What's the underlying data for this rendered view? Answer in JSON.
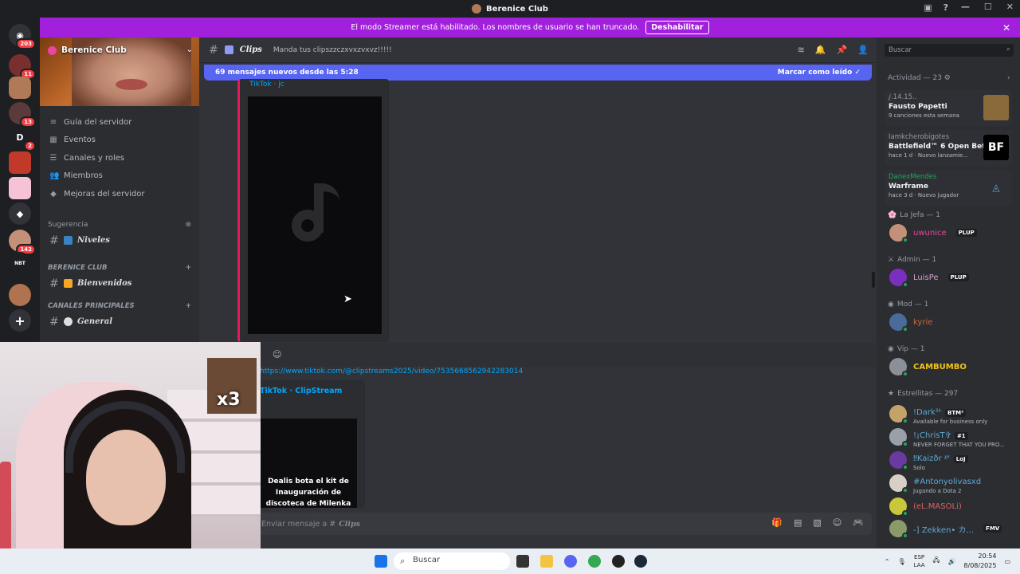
{
  "titlebar": {
    "title": "Berenice Club"
  },
  "guilds": [
    {
      "badge": "203"
    },
    {
      "badge": "11"
    },
    {
      "badge": ""
    },
    {
      "badge": "13"
    },
    {
      "badge": "2",
      "letter": "D"
    },
    {
      "badge": ""
    },
    {
      "badge": ""
    },
    {
      "badge": ""
    },
    {
      "badge": "142"
    },
    {
      "badge": "",
      "letter": "NBT"
    },
    {
      "badge": ""
    }
  ],
  "banner": {
    "text": "El modo Streamer está habilitado. Los nombres de usuario se han truncado.",
    "button": "Deshabilitar"
  },
  "sidebar": {
    "server_name": "Berenice Club",
    "menu": [
      {
        "icon": "≡",
        "label": "Guía del servidor"
      },
      {
        "icon": "▦",
        "label": "Eventos"
      },
      {
        "icon": "☰",
        "label": "Canales y roles"
      },
      {
        "icon": "👥",
        "label": "Miembros"
      },
      {
        "icon": "◆",
        "label": "Mejoras del servidor"
      }
    ],
    "suggestion_label": "Sugerencia",
    "suggestion_channel": "Niveles",
    "section1": "BERENICE CLUB",
    "channel_welcome": "Bienvenidos",
    "section2": "CANALES PRINCIPALES",
    "channel_general": "General"
  },
  "channel": {
    "name": "Clips",
    "topic": "Manda tus clipszzczxvxzvxvz!!!!!",
    "new_messages": "69 mensajes nuevos desde las 5:28",
    "mark_read": "Marcar como leído"
  },
  "messages": {
    "embed1_source": "TikTok · jc",
    "link": "https://www.tiktok.com/@clipstreams2025/video/7535668562942283014",
    "embed2_source": "TikTok · ClipStream",
    "embed2_caption": "Dealis bota el kit de Inauguración de discoteca de Milenka"
  },
  "composer": {
    "placeholder": "Enviar mensaje a #",
    "channel": "Clips"
  },
  "search": {
    "placeholder": "Buscar"
  },
  "activity": {
    "heading": "Actividad — 23",
    "cards": [
      {
        "who": "ⅉ.14.15..",
        "title": "Fausto Papetti",
        "sub": "9 canciones esta semana",
        "color": "#8a6a3a"
      },
      {
        "who": "Iamkcherobigotes",
        "title": "Battlefield™ 6 Open Beta",
        "sub": "hace 1 d · Nuevo lanzamie...",
        "color": "#000000",
        "img_text": "BF"
      },
      {
        "who": "DanexMendes",
        "title": "Warframe",
        "sub": "hace 3 d · Nuevo jugador",
        "color": "#2b2d31"
      }
    ]
  },
  "members": {
    "role_jefa": "La Jefa — 1",
    "jefa": {
      "name": "uwunice",
      "tag": "PLUP",
      "color": "#eb459f"
    },
    "role_admin": "Admin — 1",
    "admin": {
      "name": "LuisPe",
      "tag": "PLUP",
      "color": "#d49ec8"
    },
    "role_mod": "Mod — 1",
    "mod": {
      "name": "kyrie",
      "color": "#d06a3a"
    },
    "role_vip": "Vip — 1",
    "vip": {
      "name": "CAMBUMBO",
      "color": "#f0c419"
    },
    "role_stars": "Estrellitas — 297",
    "stars": [
      {
        "name": "!Dark²ᵏ",
        "tag": "BTM²",
        "status": "Available for business only"
      },
      {
        "name": "!¡ChrisT✞",
        "tag": "#1",
        "status": "NEVER FORGET THAT YOU PRO..."
      },
      {
        "name": "‼Kaizðr ᵡᵏ",
        "tag": "LoJ",
        "status": "Solo"
      },
      {
        "name": "#Antonyolivasxd",
        "tag": "",
        "status": "Jugando a Dota 2"
      },
      {
        "name": "(eL.MASOLi)",
        "tag": "",
        "status": ""
      },
      {
        "name": "-] Zekken• カ...",
        "tag": "FMV",
        "status": ""
      }
    ]
  },
  "taskbar": {
    "search": "Buscar",
    "lang1": "ESP",
    "lang2": "LAA",
    "time": "20:54",
    "date": "8/08/2025"
  },
  "webcam": {
    "overlay": "x3"
  },
  "colors": {
    "accent": "#5865f2",
    "banner": "#a120dc",
    "embed_bar": "#e7195c"
  }
}
